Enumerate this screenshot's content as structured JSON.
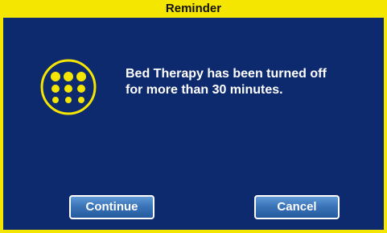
{
  "dialog": {
    "title": "Reminder",
    "message_line1": "Bed Therapy has been turned off",
    "message_line2": "for more than 30 minutes.",
    "icon": "bed-therapy-dots-icon",
    "buttons": {
      "continue_label": "Continue",
      "cancel_label": "Cancel"
    }
  },
  "colors": {
    "frame": "#f5e600",
    "background": "#0e2a6e",
    "icon": "#f5e600",
    "button": "#3b74b8",
    "text": "#ffffff"
  }
}
